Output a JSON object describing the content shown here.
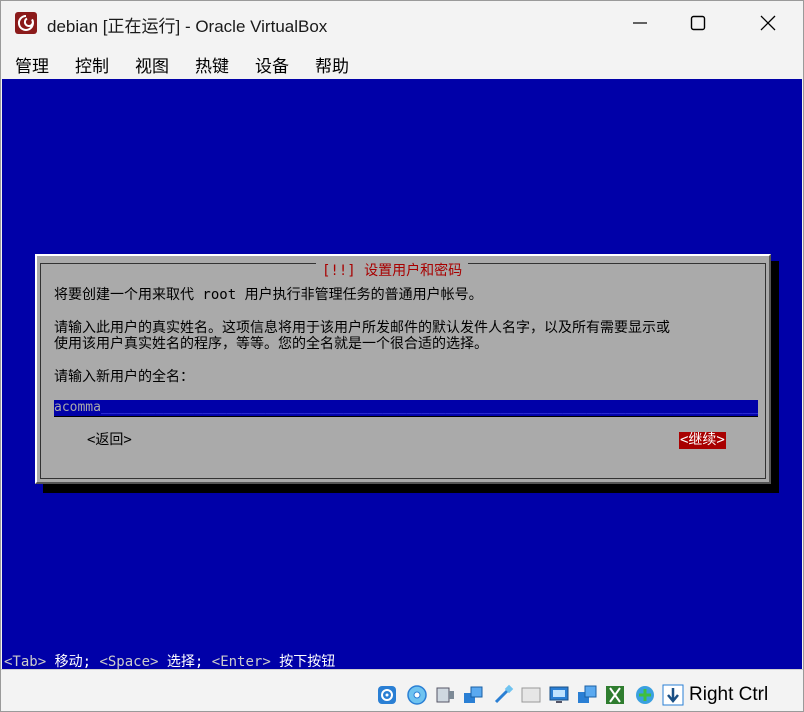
{
  "window": {
    "title": "debian [正在运行] - Oracle VirtualBox",
    "controls": [
      "minimize",
      "maximize",
      "close"
    ]
  },
  "menu": [
    "管理",
    "控制",
    "视图",
    "热键",
    "设备",
    "帮助"
  ],
  "installer": {
    "dialog_title": "[!!] 设置用户和密码",
    "intro": "将要创建一个用来取代 root 用户执行非管理任务的普通用户帐号。",
    "description_line1": "请输入此用户的真实姓名。这项信息将用于该用户所发邮件的默认发件人名字，以及所有需要显示或",
    "description_line2": "使用该用户真实姓名的程序，等等。您的全名就是一个很合适的选择。",
    "prompt": "请输入新用户的全名：",
    "full_name_value": "acomma",
    "back_button": "<返回>",
    "continue_button": "<继续>",
    "help_line": {
      "k1": "<Tab>",
      "t1": " 移动; ",
      "k2": "<Space>",
      "t2": " 选择; ",
      "k3": "<Enter>",
      "t3": " 按下按钮"
    }
  },
  "statusbar": {
    "host_key": "Right Ctrl",
    "icons": [
      "hard-disk-icon",
      "optical-drive-icon",
      "audio-icon",
      "network-icon",
      "usb-icon",
      "shared-folders-icon",
      "display-icon",
      "recording-icon",
      "mouse-integration-icon",
      "cpu-icon",
      "host-key-arrow-icon"
    ]
  },
  "colors": {
    "vm_background": "#0000a8",
    "dialog_background": "#aaaaaa",
    "dialog_title": "#a80000",
    "continue_button_bg": "#a80000"
  }
}
